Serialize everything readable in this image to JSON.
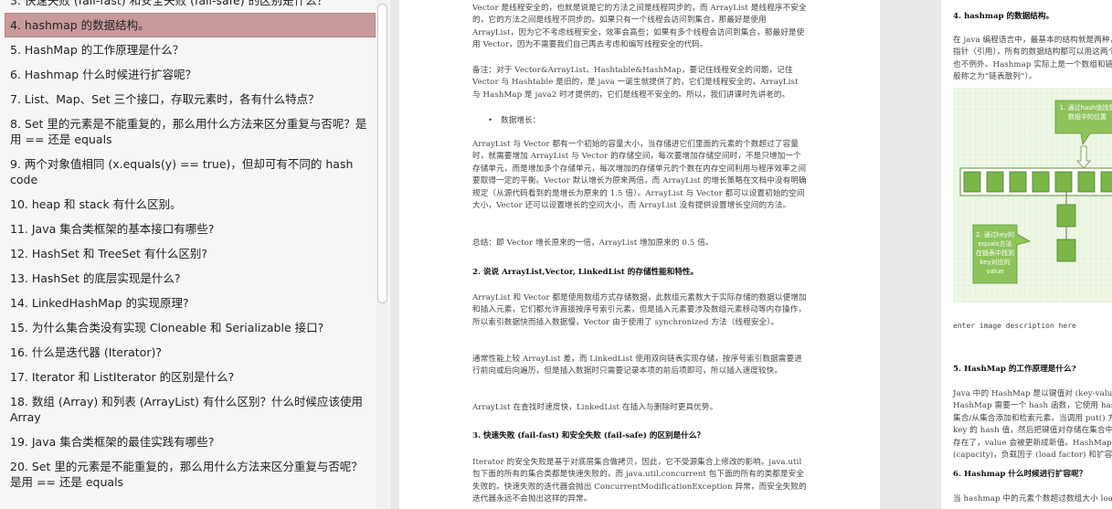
{
  "sidebar": {
    "items": [
      {
        "label": "3. 快速失败 (fail-fast) 和安全失败 (fail-safe) 的区别是什么？"
      },
      {
        "label": "4. hashmap 的数据结构。",
        "active": true
      },
      {
        "label": "5. HashMap 的工作原理是什么？"
      },
      {
        "label": "6. Hashmap 什么时候进行扩容呢？"
      },
      {
        "label": "7. List、Map、Set 三个接口，存取元素时，各有什么特点？"
      },
      {
        "label": "8. Set 里的元素是不能重复的，那么用什么方法来区分重复与否呢？是用 == 还是 equals"
      },
      {
        "label": "9. 两个对象值相同 (x.equals(y) == true)，但却可有不同的 hash code"
      },
      {
        "label": "10. heap 和 stack 有什么区别。"
      },
      {
        "label": "11. Java 集合类框架的基本接口有哪些?"
      },
      {
        "label": "12. HashSet 和 TreeSet 有什么区别?"
      },
      {
        "label": "13. HashSet 的底层实现是什么?"
      },
      {
        "label": "14. LinkedHashMap 的实现原理?"
      },
      {
        "label": "15. 为什么集合类没有实现 Cloneable 和 Serializable 接口?"
      },
      {
        "label": "16. 什么是迭代器 (Iterator)?"
      },
      {
        "label": "17. Iterator 和 ListIterator 的区别是什么?"
      },
      {
        "label": "18. 数组 (Array) 和列表 (ArrayList) 有什么区别？什么时候应该使用 Array"
      },
      {
        "label": "19. Java 集合类框架的最佳实践有哪些?"
      },
      {
        "label": "20. Set 里的元素是不能重复的，那么用什么方法来区分重复与否呢？是用 == 还是 equals"
      }
    ]
  },
  "page1": {
    "p1": "Vector 是线程安全的，也就是说是它的方法之间是线程同步的，而 ArrayList 是线程序不安全的，它的方法之间是线程不同步的。如果只有一个线程会访问到集合，那最好是使用 ArrayList，因为它不考虑线程安全，效率会高些；如果有多个线程会访问到集合，那最好是使用 Vector，因为不需要我们自己再去考虑和编写线程安全的代码。",
    "p2": "备注：对于 Vector&ArrayList、Hashtable&HashMap，要记住线程安全的问题，记住 Vector 与 Hashtable 是旧的，是 java 一诞生就提供了的，它们是线程安全的，ArrayList 与 HashMap 是 java2 时才提供的，它们是线程不安全的。所以，我们讲课时先讲老的。",
    "bullet": "数据增长：",
    "p3": "ArrayList 与 Vector 都有一个初始的容量大小，当存储进它们里面的元素的个数超过了容量时，就需要增加 ArrayList 与 Vector 的存储空间，每次要增加存储空间时，不是只增加一个存储单元，而是增加多个存储单元，每次增加的存储单元的个数在内存空间利用与程序效率之间要取得一定的平衡。Vector 默认增长为原来两倍，而 ArrayList 的增长策略在文档中没有明确规定（从源代码看到的是增长为原来的 1.5 倍）。ArrayList 与 Vector 都可以设置初始的空间大小，Vector 还可以设置增长的空间大小，而 ArrayList 没有提供设置增长空间的方法。",
    "p4": "总结：即 Vector 增长原来的一倍，ArrayList 增加原来的 0.5 倍。",
    "h2": "2. 说说 ArrayList,Vector, LinkedList 的存储性能和特性。",
    "p5": "ArrayList 和 Vector 都是使用数组方式存储数据，此数组元素数大于实际存储的数据以便增加和插入元素，它们都允许直接按序号索引元素，但是插入元素要涉及数组元素移动等内存操作，所以索引数据快而插入数据慢，Vector 由于使用了 synchronized 方法（线程安全）。",
    "p6": "通常性能上较 ArrayList 差，而 LinkedList 使用双向链表实现存储，按序号索引数据需要进行前向或后向遍历，但是插入数据时只需要记录本项的前后项即可，所以插入速度较快。",
    "p7": "ArrayList 在查找时速度快，LinkedList 在插入与删除时更具优势。",
    "h3": "3. 快速失败 (fail-fast) 和安全失败 (fail-safe) 的区别是什么？",
    "p8": "Iterator 的安全失败是基于对底层集合做拷贝，因此，它不受源集合上修改的影响。java.util 包下面的所有的集合类都是快速失败的，而 java.util.concurrent 包下面的所有的类都是安全失败的。快速失败的迭代器会抛出 ConcurrentModificationException 异常，而安全失败的迭代器永远不会抛出这样的异常。"
  },
  "page2": {
    "h4": "4. hashmap 的数据结构。",
    "p1": "在 java 编程语言中，最基本的结构就是两种，一个是数组，另外一个是模拟指针（引用），所有的数据结构都可以用这两个基本结构来构造的，hashmap 也不例外。Hashmap 实际上是一个数组和链表的结合体（在数据结构中，一般称之为“链表散列”）。",
    "diagram_label1": "1. 通过hash值找到数组中的位置",
    "diagram_label2": "2. 通过key的equals方法在链表中找到key对应的value",
    "caption": "enter image description here",
    "h5": "5. HashMap 的工作原理是什么?",
    "p2": "Java 中的 HashMap 是以键值对 (key-value) 的形式存储元素的。HashMap 需要一个 hash 函数，它使用 hashCode() 和 equals()方法来向集合/从集合添加和检索元素。当调用 put() 方法的时候，HashMap 会计算 key 的 hash 值，然后把键值对存储在集合中合适的索引上。如果 key 已经存在了，value 会被更新成新值。HashMap 的一些重要的特性是它的容量 (capacity)，负载因子 (load factor) 和扩容极限 (threshold resizing)。",
    "h6": "6. Hashmap 什么时候进行扩容呢？",
    "p3": "当 hashmap 中的元素个数超过数组大小 loadFactor 时，就会进行数组扩容"
  },
  "colors": {
    "active_bg": "#c99a9c",
    "diagram_green": "#7ab648",
    "diagram_bg": "#eef7e6"
  }
}
